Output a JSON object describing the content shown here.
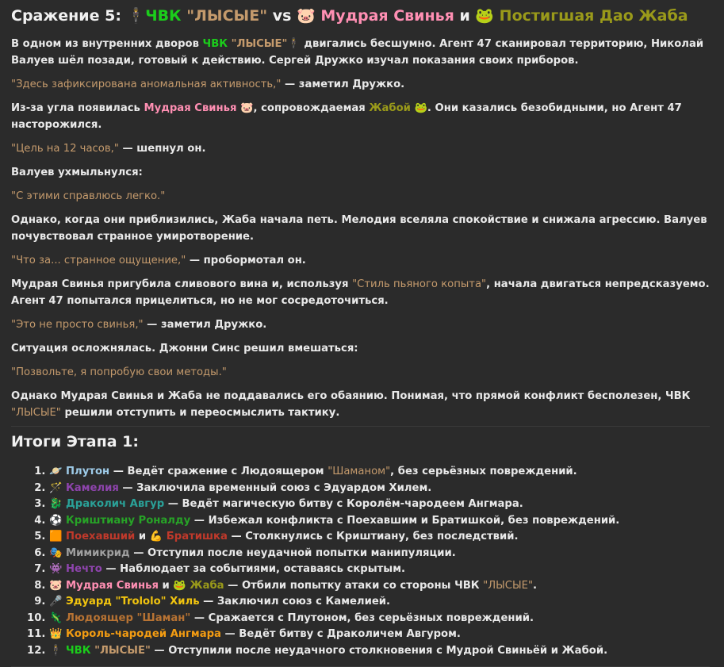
{
  "title": {
    "prefix": "Сражение 5: ",
    "agent_icon": "🕴",
    "pmc": "ЧВК",
    "pmc_name": "\"ЛЫСЫЕ\"",
    "vs": " vs ",
    "pig_icon": "🐷",
    "pig": "Мудрая Свинья",
    "and": " и ",
    "frog_icon": "🐸",
    "frog": "Постигшая Дао Жаба"
  },
  "story": {
    "p1_a": "В одном из внутренних дворов ",
    "p1_pmc": "ЧВК",
    "p1_pmc_name": "\"ЛЫСЫЕ\"",
    "p1_icon": "🕴",
    "p1_b": " двигались бесшумно. Агент 47 сканировал территорию, Николай Валуев шёл позади, готовый к действию. Сергей Дружко изучал показания своих приборов.",
    "q1": "\"Здесь зафиксирована аномальная активность,\"",
    "q1_after": " — заметил Дружко.",
    "p2_a": "Из-за угла появилась ",
    "p2_pig": "Мудрая Свинья",
    "p2_pig_icon": "🐷",
    "p2_b": ", сопровождаемая ",
    "p2_frog": "Жабой",
    "p2_frog_icon": "🐸",
    "p2_c": ". Они казались безобидными, но Агент 47 насторожился.",
    "q2": "\"Цель на 12 часов,\"",
    "q2_after": " — шепнул он.",
    "p3": "Валуев ухмыльнулся:",
    "q3": "\"С этими справлюсь легко.\"",
    "p4": "Однако, когда они приблизились, Жаба начала петь. Мелодия вселяла спокойствие и снижала агрессию. Валуев почувствовал странное умиротворение.",
    "q4": "\"Что за... странное ощущение,\"",
    "q4_after": " — пробормотал он.",
    "p5_a": "Мудрая Свинья пригубила сливового вина и, используя ",
    "p5_style": "\"Стиль пьяного копыта\"",
    "p5_b": ", начала двигаться непредсказуемо. Агент 47 попытался прицелиться, но не мог сосредоточиться.",
    "q5": "\"Это не просто свинья,\"",
    "q5_after": " — заметил Дружко.",
    "p6": "Ситуация осложнялась. Джонни Синс решил вмешаться:",
    "q6": "\"Позвольте, я попробую свои методы.\"",
    "p7_a": "Однако Мудрая Свинья и Жаба не поддавались его обаянию. Понимая, что прямой конфликт бесполезен, ЧВК ",
    "p7_name": "\"ЛЫСЫЕ\"",
    "p7_b": " решили отступить и переосмыслить тактику."
  },
  "summary": {
    "heading": "Итоги Этапа 1:",
    "items": [
      {
        "icon": "🪐",
        "name": "Плутон",
        "text_a": " — Ведёт сражение с Людоящером ",
        "quote": "\"Шаманом\"",
        "text_b": ", без серьёзных повреждений."
      },
      {
        "icon": "🪄",
        "name": "Камелия",
        "text": " — Заключила временный союз с Эдуардом Хилем."
      },
      {
        "icon": "🐉",
        "name": "Драколич Авгур",
        "text": " — Ведёт магическую битву с Королём-чародеем Ангмара."
      },
      {
        "icon": "⚽",
        "name": "Криштиану Роналду",
        "text": " — Избежал конфликта с Поехавшим и Братишкой, без повреждений."
      },
      {
        "icon": "🟧",
        "name": "Поехавший",
        "and": " и ",
        "icon2": "💪",
        "name2": "Братишка",
        "text": " — Столкнулись с Криштиану, без последствий."
      },
      {
        "icon": "🎭",
        "name": "Мимикрид",
        "text": " — Отступил после неудачной попытки манипуляции."
      },
      {
        "icon": "👾",
        "name": "Нечто",
        "text": " — Наблюдает за событиями, оставаясь скрытым."
      },
      {
        "icon": "🐷",
        "name": "Мудрая Свинья",
        "and": " и ",
        "icon2": "🐸",
        "name2": "Жаба",
        "text_a": " — Отбили попытку атаки со стороны ЧВК ",
        "quote": "\"ЛЫСЫЕ\"",
        "text_b": "."
      },
      {
        "icon": "🎤",
        "name_a": "Эдуард ",
        "quote": "\"Trololo\"",
        "name_b": " Хиль",
        "text": " — Заключил союз с Камелией."
      },
      {
        "icon": "🦎",
        "name_a": "Людоящер ",
        "quote": "\"Шаман\"",
        "text": " — Сражается с Плутоном, без серьёзных повреждений."
      },
      {
        "icon": "👑",
        "name": "Король-чародей Ангмара",
        "text": " — Ведёт битву с Драколичем Авгуром."
      },
      {
        "icon": "🕴",
        "name_a": "ЧВК",
        "quote": "\"ЛЫСЫЕ\"",
        "text": " — Отступили после неудачного столкновения с Мудрой Свиньёй и Жабой."
      }
    ]
  }
}
